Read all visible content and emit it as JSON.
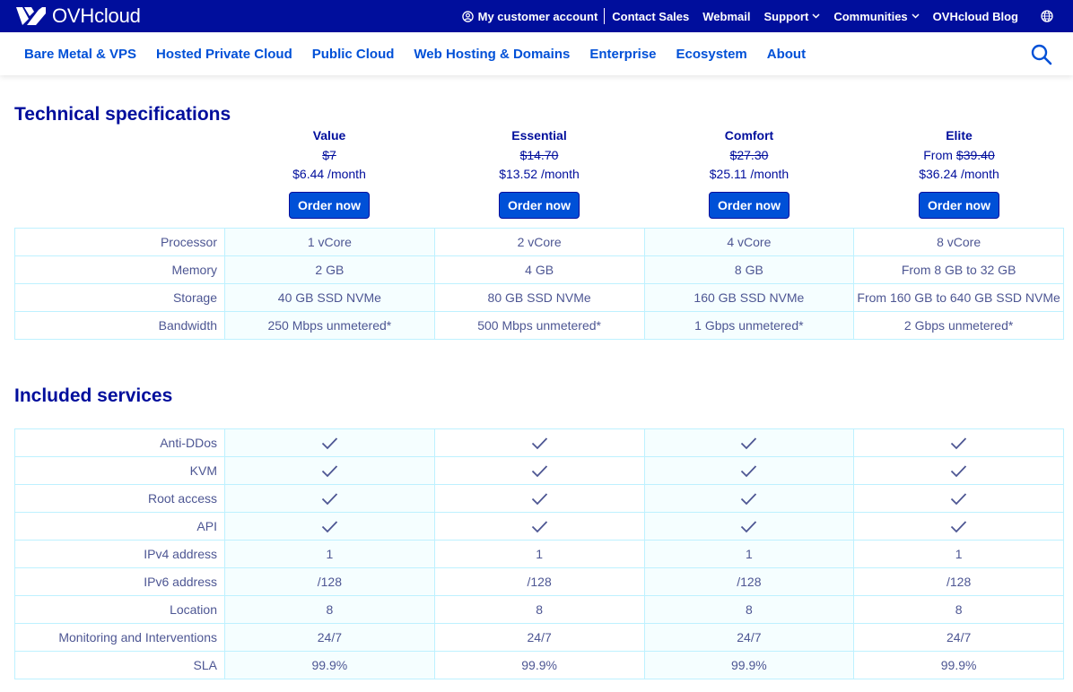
{
  "brand": {
    "name": "OVHcloud"
  },
  "topbar": {
    "links": [
      {
        "label": "My customer account",
        "icon": "user-circle-icon"
      },
      {
        "label": "Contact Sales"
      },
      {
        "label": "Webmail"
      },
      {
        "label": "Support",
        "dropdown": true
      },
      {
        "label": "Communities",
        "dropdown": true
      },
      {
        "label": "OVHcloud Blog"
      }
    ],
    "language_icon": "globe-icon"
  },
  "nav": {
    "items": [
      "Bare Metal & VPS",
      "Hosted Private Cloud",
      "Public Cloud",
      "Web Hosting & Domains",
      "Enterprise",
      "Ecosystem",
      "About"
    ],
    "search_icon": "search-icon"
  },
  "tech": {
    "title": "Technical specifications",
    "order_label": "Order now",
    "plans": [
      {
        "name": "Value",
        "from": "",
        "old_price": "$7",
        "price": "$6.44 /month"
      },
      {
        "name": "Essential",
        "from": "",
        "old_price": "$14.70",
        "price": "$13.52 /month"
      },
      {
        "name": "Comfort",
        "from": "",
        "old_price": "$27.30",
        "price": "$25.11 /month"
      },
      {
        "name": "Elite",
        "from": "From",
        "old_price": "$39.40",
        "price": "$36.24 /month"
      }
    ],
    "rows": [
      {
        "label": "Processor",
        "values": [
          "1 vCore",
          "2 vCore",
          "4 vCore",
          "8 vCore"
        ]
      },
      {
        "label": "Memory",
        "values": [
          "2 GB",
          "4 GB",
          "8 GB",
          "From 8 GB to 32 GB"
        ]
      },
      {
        "label": "Storage",
        "values": [
          "40 GB SSD NVMe",
          "80 GB SSD NVMe",
          "160 GB SSD NVMe",
          "From 160 GB to 640 GB SSD NVMe"
        ]
      },
      {
        "label": "Bandwidth",
        "values": [
          "250 Mbps unmetered*",
          "500 Mbps unmetered*",
          "1 Gbps unmetered*",
          "2 Gbps unmetered*"
        ]
      }
    ]
  },
  "included": {
    "title": "Included services",
    "rows": [
      {
        "label": "Anti-DDos",
        "check": true,
        "values": [
          "",
          "",
          "",
          ""
        ]
      },
      {
        "label": "KVM",
        "check": true,
        "values": [
          "",
          "",
          "",
          ""
        ]
      },
      {
        "label": "Root access",
        "check": true,
        "values": [
          "",
          "",
          "",
          ""
        ]
      },
      {
        "label": "API",
        "check": true,
        "values": [
          "",
          "",
          "",
          ""
        ]
      },
      {
        "label": "IPv4 address",
        "check": false,
        "values": [
          "1",
          "1",
          "1",
          "1"
        ]
      },
      {
        "label": "IPv6 address",
        "check": false,
        "values": [
          "/128",
          "/128",
          "/128",
          "/128"
        ]
      },
      {
        "label": "Location",
        "check": false,
        "values": [
          "8",
          "8",
          "8",
          "8"
        ]
      },
      {
        "label": "Monitoring and Interventions",
        "check": false,
        "values": [
          "24/7",
          "24/7",
          "24/7",
          "24/7"
        ]
      },
      {
        "label": "SLA",
        "check": false,
        "values": [
          "99.9%",
          "99.9%",
          "99.9%",
          "99.9%"
        ]
      }
    ]
  },
  "colors": {
    "brand_dark": "#000e9c",
    "link_blue": "#0050d7",
    "text": "#4d5693",
    "border": "#bef1ff",
    "shade": "#f5feff"
  }
}
